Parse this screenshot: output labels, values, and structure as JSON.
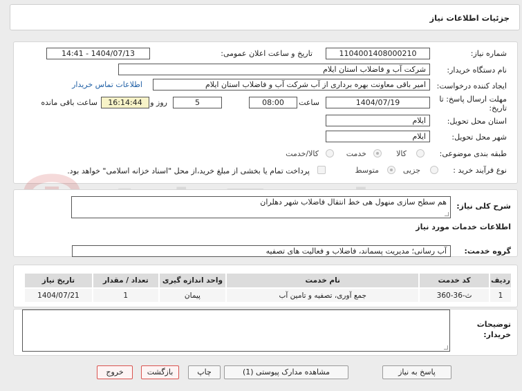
{
  "header": {
    "title": "جزئیات اطلاعات نیاز"
  },
  "form": {
    "need_number_label": "شماره نیاز:",
    "need_number": "1104001408000210",
    "announce_label": "تاریخ و ساعت اعلان عمومی:",
    "announce_value": "1404/07/13 - 14:41",
    "buyer_org_label": "نام دستگاه خریدار:",
    "buyer_org": "شرکت آب و فاضلاب استان ایلام",
    "requester_label": "ایجاد کننده درخواست:",
    "requester": "امیر باقی معاونت بهره برداری از آب شرکت آب و فاضلاب استان ایلام",
    "contact_link": "اطلاعات تماس خریدار",
    "deadline_label_1": "مهلت ارسال پاسخ: تا",
    "deadline_label_2": "تاریخ:",
    "deadline_date": "1404/07/19",
    "time_label": "ساعت",
    "deadline_time": "08:00",
    "days_value": "5",
    "days_label": "روز و",
    "remaining_time": "16:14:44",
    "remaining_label": "ساعت باقی مانده",
    "province_label": "استان محل تحویل:",
    "province": "ایلام",
    "city_label": "شهر محل تحویل:",
    "city": "ایلام",
    "category_label": "طبقه بندی موضوعی:",
    "category_options": [
      "کالا",
      "خدمت",
      "کالا/خدمت"
    ],
    "category_selected": "خدمت",
    "process_label": "نوع فرآیند خرید :",
    "process_options": [
      "جزیی",
      "متوسط"
    ],
    "process_selected": "متوسط",
    "payment_note": "پرداخت تمام یا بخشی از مبلغ خرید،از محل \"اسناد خزانه اسلامی\" خواهد بود."
  },
  "description": {
    "label": "شرح کلی نیاز:",
    "value": "هم سطح سازی منهول هی خط انتقال فاضلاب شهر دهلران"
  },
  "services": {
    "section_title": "اطلاعات خدمات مورد نیاز",
    "group_label": "گروه خدمت:",
    "group_value": "آب رسانی؛ مدیریت پسماند، فاضلاب و فعالیت های تصفیه",
    "columns": [
      "ردیف",
      "کد خدمت",
      "نام خدمت",
      "واحد اندازه گیری",
      "تعداد / مقدار",
      "تاریخ نیاز"
    ],
    "rows": [
      [
        "1",
        "ث-36-360",
        "جمع آوری، تصفیه و تامین آب",
        "پیمان",
        "1",
        "1404/07/21"
      ]
    ]
  },
  "buyer_notes": {
    "label_1": "توضیحات",
    "label_2": "خریدار:",
    "value": ""
  },
  "buttons": {
    "reply": "پاسخ به نیاز",
    "attachments": "مشاهده مدارک پیوستی (1)",
    "print": "چاپ",
    "back": "بازگشت",
    "exit": "خروج"
  },
  "watermark": "AriaTender.net"
}
